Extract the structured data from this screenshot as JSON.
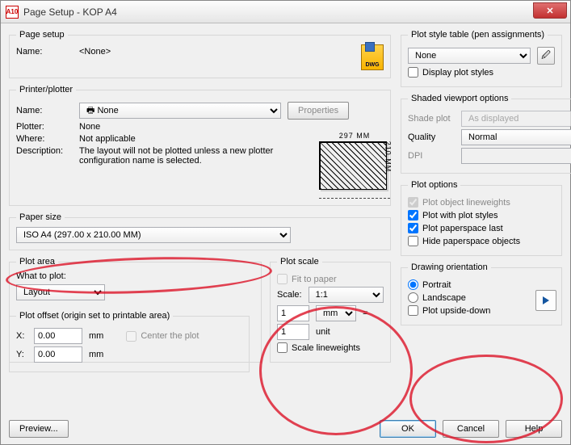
{
  "title": "Page Setup - KOP A4",
  "appicon_text": "A10",
  "dwg_label": "DWG",
  "pageSetup": {
    "legend": "Page setup",
    "nameLabel": "Name:",
    "nameValue": "<None>"
  },
  "printer": {
    "legend": "Printer/plotter",
    "nameLabel": "Name:",
    "nameValue": "🖶 None",
    "propertiesBtn": "Properties",
    "plotterLabel": "Plotter:",
    "plotterValue": "None",
    "whereLabel": "Where:",
    "whereValue": "Not applicable",
    "descLabel": "Description:",
    "descValue": "The layout will not be plotted unless a new plotter configuration name is selected.",
    "previewTop": "297 MM",
    "previewSide": "210 MM"
  },
  "paperSize": {
    "legend": "Paper size",
    "value": "ISO A4 (297.00 x 210.00 MM)"
  },
  "plotArea": {
    "legend": "Plot area",
    "whatLabel": "What to plot:",
    "whatValue": "Layout"
  },
  "plotScale": {
    "legend": "Plot scale",
    "fitLabel": "Fit to paper",
    "scaleLabel": "Scale:",
    "scaleValue": "1:1",
    "num": "1",
    "unit": "mm",
    "eq": "=",
    "denom": "1",
    "unitLabel": "unit",
    "scaleLW": "Scale lineweights"
  },
  "plotOffset": {
    "legend": "Plot offset (origin set to printable area)",
    "xLabel": "X:",
    "xValue": "0.00",
    "xUnit": "mm",
    "yLabel": "Y:",
    "yValue": "0.00",
    "yUnit": "mm",
    "centerLabel": "Center the plot"
  },
  "plotStyle": {
    "legend": "Plot style table (pen assignments)",
    "value": "None",
    "display": "Display plot styles"
  },
  "shaded": {
    "legend": "Shaded viewport options",
    "shadeLabel": "Shade plot",
    "shadeValue": "As displayed",
    "qualityLabel": "Quality",
    "qualityValue": "Normal",
    "dpiLabel": "DPI",
    "dpiValue": ""
  },
  "plotOptions": {
    "legend": "Plot options",
    "o1": "Plot object lineweights",
    "o2": "Plot with plot styles",
    "o3": "Plot paperspace last",
    "o4": "Hide paperspace objects"
  },
  "orientation": {
    "legend": "Drawing orientation",
    "portrait": "Portrait",
    "landscape": "Landscape",
    "upside": "Plot upside-down"
  },
  "buttons": {
    "preview": "Preview...",
    "ok": "OK",
    "cancel": "Cancel",
    "help": "Help"
  }
}
